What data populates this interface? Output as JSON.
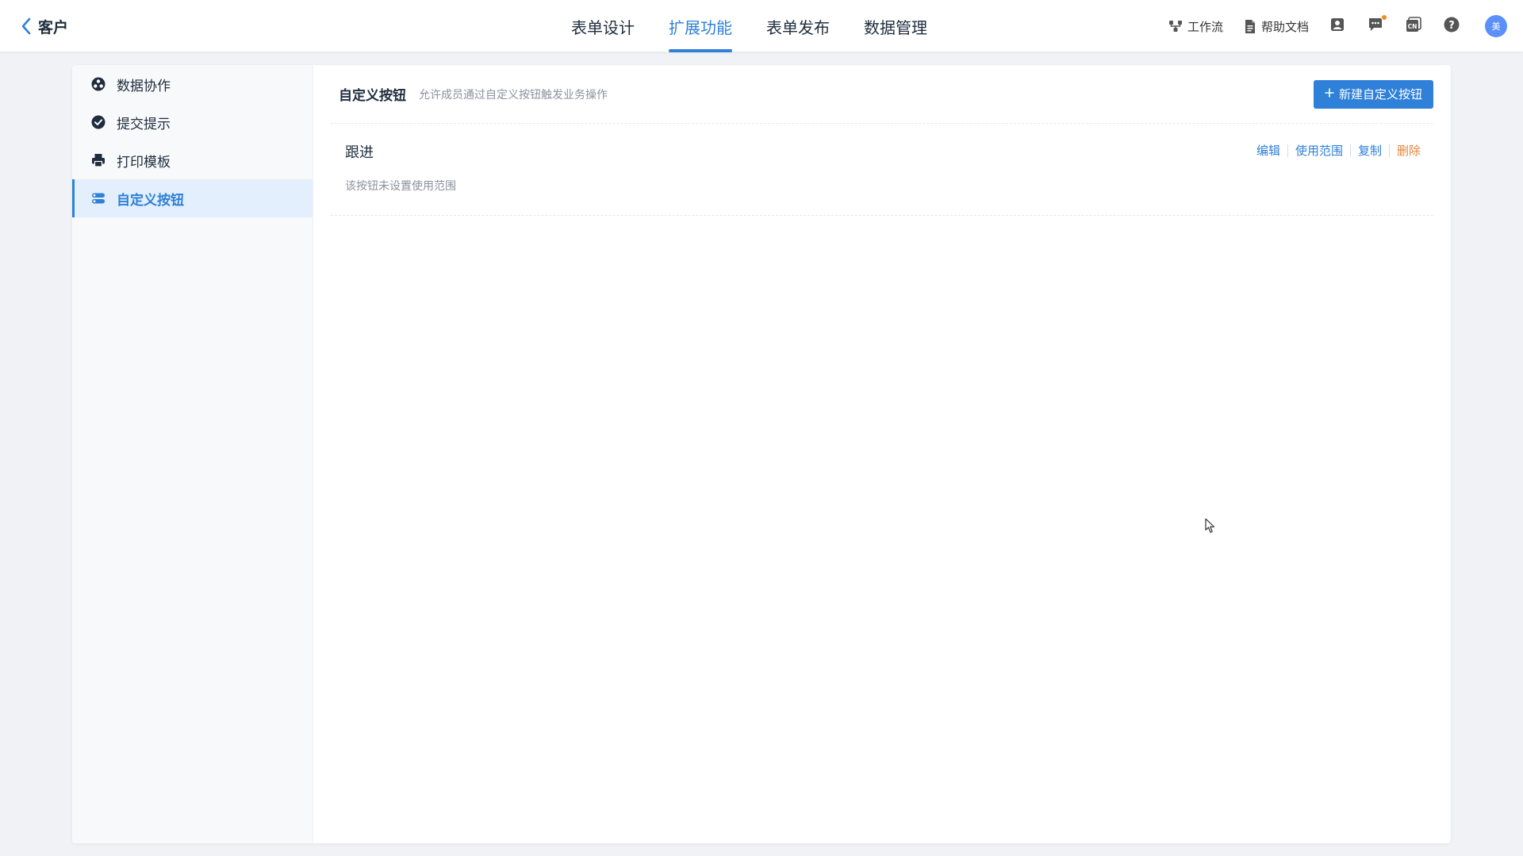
{
  "header": {
    "back_title": "客户",
    "tabs": [
      {
        "label": "表单设计",
        "active": false
      },
      {
        "label": "扩展功能",
        "active": true
      },
      {
        "label": "表单发布",
        "active": false
      },
      {
        "label": "数据管理",
        "active": false
      }
    ],
    "tools": {
      "workflow_label": "工作流",
      "help_docs_label": "帮助文档",
      "avatar_text": "美"
    }
  },
  "sidebar": {
    "items": [
      {
        "label": "数据协作",
        "icon": "data-collab-icon",
        "active": false
      },
      {
        "label": "提交提示",
        "icon": "check-circle-icon",
        "active": false
      },
      {
        "label": "打印模板",
        "icon": "printer-icon",
        "active": false
      },
      {
        "label": "自定义按钮",
        "icon": "custom-button-icon",
        "active": true
      }
    ]
  },
  "main": {
    "title": "自定义按钮",
    "description": "允许成员通过自定义按钮触发业务操作",
    "new_button_label": "新建自定义按钮",
    "buttons": [
      {
        "name": "跟进",
        "scope_text": "该按钮未设置使用范围",
        "actions": {
          "edit": "编辑",
          "scope": "使用范围",
          "copy": "复制",
          "delete": "删除"
        }
      }
    ]
  },
  "colors": {
    "accent": "#2f80d8",
    "danger": "#e3843c",
    "notification_dot": "#f08a24"
  }
}
